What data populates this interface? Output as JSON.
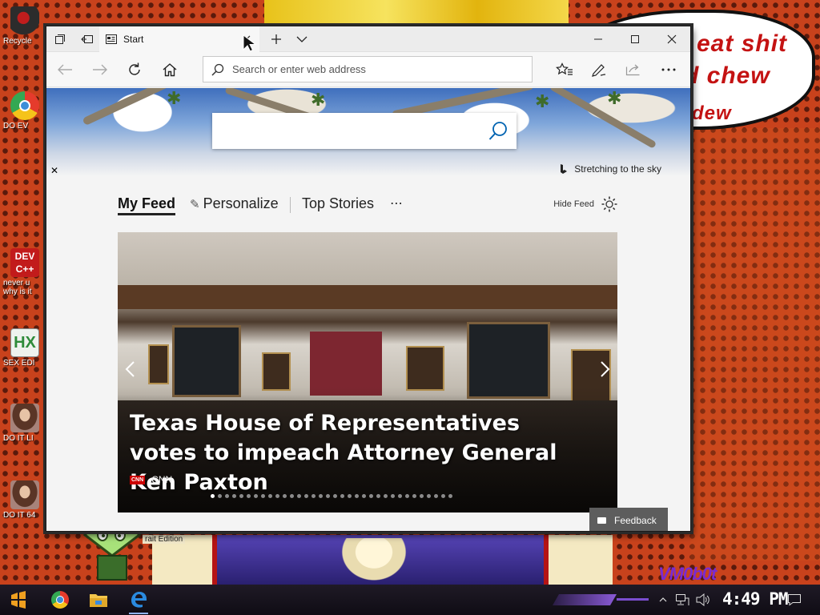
{
  "desktop": {
    "speech_lines": [
      "eat shit",
      "d chew",
      "dew"
    ],
    "icons": [
      {
        "label": "Recycle",
        "icon": "recycle-bin-icon",
        "color": "#2c2c2c"
      },
      {
        "label": "DO EV",
        "icon": "chrome-icon",
        "color": "#3b8fd8"
      },
      {
        "label": "never u why is it",
        "icon": "devcpp-icon",
        "color": "#c21b1b"
      },
      {
        "label": "SEX EDI",
        "icon": "hxd-icon",
        "color": "#2e8b3a"
      },
      {
        "label": "DO IT LI",
        "icon": "portrait-icon",
        "color": "#7a4a38"
      },
      {
        "label": "DO IT 64",
        "icon": "portrait-icon",
        "color": "#7a4a38"
      }
    ],
    "gem_caption": "rait Edition",
    "vm_text": "VM0b0t"
  },
  "browser": {
    "tab_title": "Start",
    "address_placeholder": "Search or enter web address"
  },
  "newtab": {
    "bing_credit": "Stretching to the sky",
    "feed_tabs": [
      "My Feed",
      "Personalize",
      "Top Stories",
      "⋯"
    ],
    "hide_feed": "Hide Feed",
    "headline": "Texas House of Representatives votes to impeach Attorney General Ken Paxton",
    "source_logo": "CNN",
    "source_name": "CNN",
    "dots_total": 34,
    "dot_active_index": 0,
    "feedback_label": "Feedback"
  },
  "taskbar": {
    "clock": "4:49 PM",
    "apps": [
      "start-icon",
      "chrome-icon",
      "file-explorer-icon",
      "edge-icon"
    ]
  },
  "colors": {
    "accent": "#0063b1",
    "title_bar": "#ececec",
    "feedback_bg": "#5d5d5d",
    "cnn_red": "#cc0000"
  }
}
